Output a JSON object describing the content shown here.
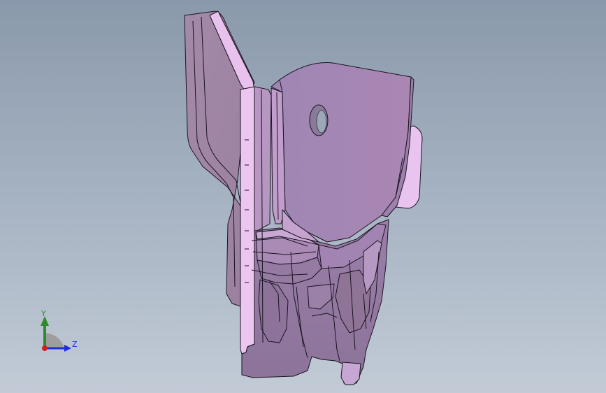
{
  "viewport": {
    "background_top": "#8a99ab",
    "background_bottom": "#c2cbd6"
  },
  "part": {
    "name": "sheet-metal-bracket",
    "base_color": "#a687b4",
    "highlight_color": "#e9c3ee",
    "edge_color": "#1a1420"
  },
  "triad": {
    "y_label": "Y",
    "z_label": "Z",
    "y_color": "#2f8a2f",
    "z_color": "#1d2fd0",
    "x_color": "#d22020"
  }
}
